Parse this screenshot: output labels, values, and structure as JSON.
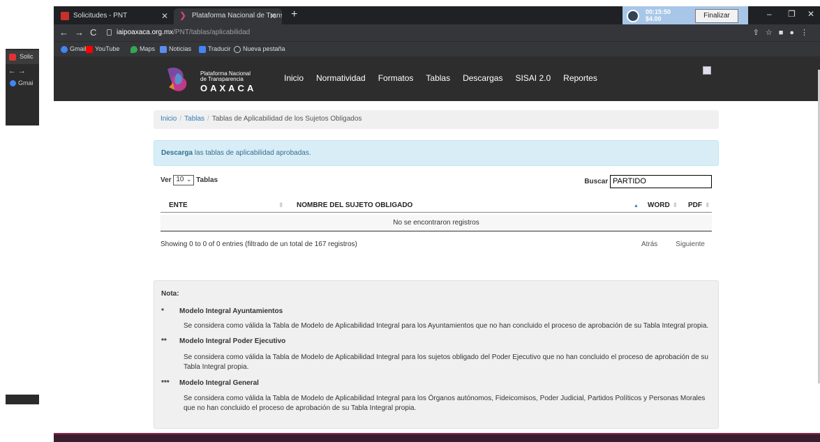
{
  "background_window": {
    "tab_label": "Solic",
    "bookmark_label": "Gmai"
  },
  "browser": {
    "tabs": [
      {
        "label": "Solicitudes - PNT"
      },
      {
        "label": "Plataforma Nacional de Transpar"
      }
    ],
    "new_tab": "+",
    "window_controls": {
      "minimize": "–",
      "restore": "❐",
      "close": "✕"
    },
    "url_host": "iaipoaxaca.org.mx",
    "url_path": "/PNT/tablas/aplicabilidad",
    "bookmarks": [
      "Gmail",
      "YouTube",
      "Maps",
      "Noticias",
      "Traducir",
      "Nueva pestaña"
    ]
  },
  "timer": {
    "time": "00:15:50",
    "cost": "$4.00",
    "button": "Finalizar"
  },
  "site": {
    "logo_line1": "Plataforma Nacional",
    "logo_line2": "de Transparencia",
    "logo_line3": "OAXACA",
    "menu": [
      "Inicio",
      "Normatividad",
      "Formatos",
      "Tablas",
      "Descargas",
      "SISAI 2.0",
      "Reportes"
    ]
  },
  "breadcrumb": {
    "items": [
      "Inicio",
      "Tablas"
    ],
    "current": "Tablas de Aplicabilidad de los Sujetos Obligados",
    "separator": "/"
  },
  "info": {
    "bold": "Descarga",
    "text": " las tablas de aplicabilidad aprobadas."
  },
  "table_controls": {
    "show_label": "Ver",
    "page_size": "10",
    "after_label": "Tablas",
    "search_label": "Buscar",
    "search_value": "PARTIDO"
  },
  "table": {
    "columns": [
      "ENTE",
      "NOMBRE DEL SUJETO OBLIGADO",
      "WORD",
      "PDF"
    ],
    "empty_message": "No se encontraron registros",
    "info": "Showing 0 to 0 of 0 entries (filtrado de un total de 167 registros)",
    "prev": "Atrás",
    "next": "Siguiente"
  },
  "nota": {
    "title": "Nota:",
    "items": [
      {
        "stars": "*",
        "heading": "Modelo Integral Ayuntamientos",
        "text": "Se considera como válida la Tabla de Modelo de Aplicabilidad Integral para los Ayuntamientos que no han concluido el proceso de aprobación de su Tabla Integral propia."
      },
      {
        "stars": "**",
        "heading": "Modelo Integral Poder Ejecutivo",
        "text": "Se considera como válida la Tabla de Modelo de Aplicabilidad Integral para los sujetos obligado del Poder Ejecutivo que no han concluido el proceso de aprobación de su Tabla Integral propia."
      },
      {
        "stars": "***",
        "heading": "Modelo Integral General",
        "text": "Se considera como válida la Tabla de Modelo de Aplicabilidad Integral para los Órganos autónomos, Fideicomisos, Poder Judicial, Partidos Políticos y Personas Morales que no han concluido el proceso de aprobación de su Tabla Integral propia."
      }
    ]
  },
  "colors": {
    "link": "#337ab7",
    "info_bg": "#d9edf7",
    "header_bg": "#2d2d2d",
    "brand": "#8a2a4f"
  }
}
